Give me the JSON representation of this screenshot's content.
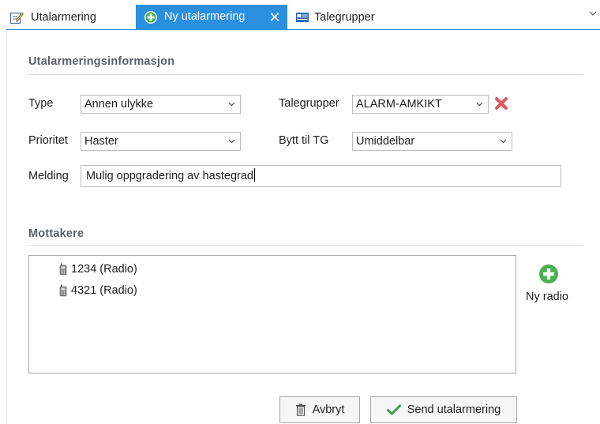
{
  "tabs": [
    {
      "label": "Utalarmering",
      "icon": "edit-form-icon",
      "active": false
    },
    {
      "label": "Ny utalarmering",
      "icon": "add-circle-icon",
      "active": true
    },
    {
      "label": "Talegrupper",
      "icon": "card-icon",
      "active": false
    }
  ],
  "accent_color": "#2b8fe0",
  "info_section": {
    "title": "Utalarmeringsinformasjon",
    "type_label": "Type",
    "type_value": "Annen ulykke",
    "prioritet_label": "Prioritet",
    "prioritet_value": "Haster",
    "talegrupper_label": "Talegrupper",
    "talegrupper_value": "ALARM-AMKIKT",
    "bytt_label": "Bytt til TG",
    "bytt_value": "Umiddelbar",
    "melding_label": "Melding",
    "melding_value": "Mulig oppgradering av hastegrad"
  },
  "recipients_section": {
    "title": "Mottakere",
    "items": [
      {
        "label": "1234 (Radio)"
      },
      {
        "label": "4321 (Radio)"
      }
    ],
    "add_radio_label": "Ny radio"
  },
  "buttons": {
    "cancel_label": "Avbryt",
    "send_label": "Send utalarmering"
  }
}
